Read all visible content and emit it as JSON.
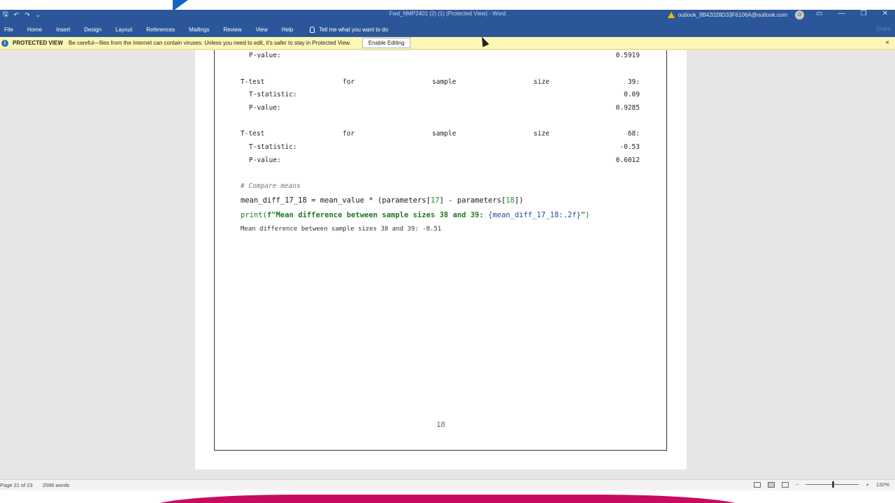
{
  "titlebar": {
    "doc_title": "Fwd_NMP2401 (2) (1) (Protected View) - Word",
    "account": "outlook_9B42028D33F6106A@outlook.com",
    "qat_save": "🖫",
    "qat_undo": "↶",
    "qat_redo": "↷",
    "qat_more": "⌄",
    "avatar_initial": "O",
    "win_ribbon": "▭",
    "win_min": "—",
    "win_max": "❐",
    "win_close": "✕"
  },
  "ribbon": {
    "tabs": [
      "File",
      "Home",
      "Insert",
      "Design",
      "Layout",
      "References",
      "Mailings",
      "Review",
      "View",
      "Help"
    ],
    "tell_me": "Tell me what you want to do",
    "share": "Share"
  },
  "protected_view": {
    "title": "PROTECTED VIEW",
    "message": "Be careful—files from the Internet can contain viruses. Unless you need to edit, it's safer to stay in Protected View.",
    "button": "Enable Editing",
    "info": "i",
    "close": "×"
  },
  "document": {
    "top_pvalue": {
      "label": "P-value:",
      "value": "0.5919"
    },
    "tests": [
      {
        "w1": "T-test",
        "w2": "for",
        "w3": "sample",
        "w4": "size",
        "size": "39:",
        "t_label": "T-statistic:",
        "t_value": "0.09",
        "p_label": "P-value:",
        "p_value": "0.9285"
      },
      {
        "w1": "T-test",
        "w2": "for",
        "w3": "sample",
        "w4": "size",
        "size": "68:",
        "t_label": "T-statistic:",
        "t_value": "-0.53",
        "p_label": "P-value:",
        "p_value": "0.6012"
      }
    ],
    "code": {
      "comment": "# Compare means",
      "line2_a": "mean_diff_17_18 = mean_value * (parameters[",
      "line2_n1": "17",
      "line2_b": "] - parameters[",
      "line2_n2": "18",
      "line2_c": "])",
      "line3_print": "print(",
      "line3_str": "f\"Mean difference between sample sizes 38 and 39: ",
      "line3_expr": "{mean_diff_17_18:.2f}",
      "line3_end_str": "\"",
      "line3_close": ")"
    },
    "output": "Mean difference between sample sizes 38 and 39: -8.51",
    "page_number": "18"
  },
  "statusbar": {
    "page": "Page 21 of 23",
    "words": "2596 words",
    "zoom": "132%",
    "zoom_minus": "−",
    "zoom_plus": "+"
  }
}
